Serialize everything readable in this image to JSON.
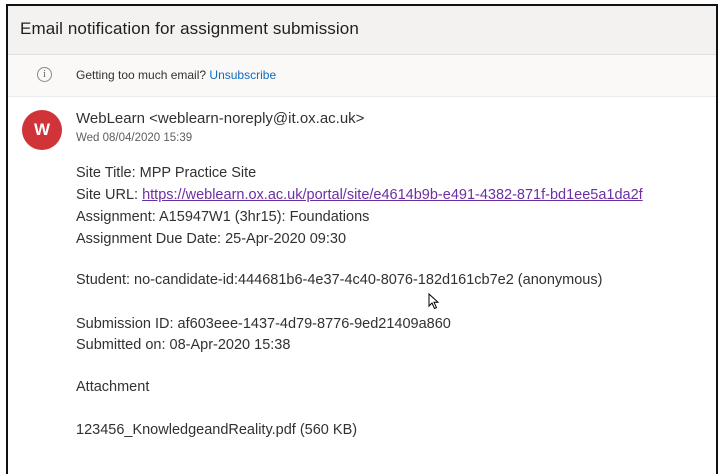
{
  "subject": "Email notification for assignment submission",
  "notice": {
    "icon": "info-icon",
    "text": "Getting too much email?",
    "link_label": "Unsubscribe"
  },
  "sender": {
    "avatar_letter": "W",
    "avatar_color": "#d13438",
    "display": "WebLearn <weblearn-noreply@it.ox.ac.uk>",
    "date": "Wed 08/04/2020 15:39"
  },
  "body": {
    "site_title": "Site Title: MPP Practice Site",
    "site_url_label": "Site URL:",
    "site_url": "https://weblearn.ox.ac.uk/portal/site/e4614b9b-e491-4382-871f-bd1ee5a1da2f",
    "assignment": "Assignment: A15947W1 (3hr15): Foundations",
    "due_date": "Assignment Due Date: 25-Apr-2020 09:30",
    "student": "Student: no-candidate-id:444681b6-4e37-4c40-8076-182d161cb7e2 (anonymous)",
    "submission_id": "Submission ID: af603eee-1437-4d79-8776-9ed21409a860",
    "submitted_on": "Submitted on: 08-Apr-2020 15:38",
    "attachment_label": "Attachment",
    "attachment_file": "123456_KnowledgeandReality.pdf (560 KB)"
  }
}
